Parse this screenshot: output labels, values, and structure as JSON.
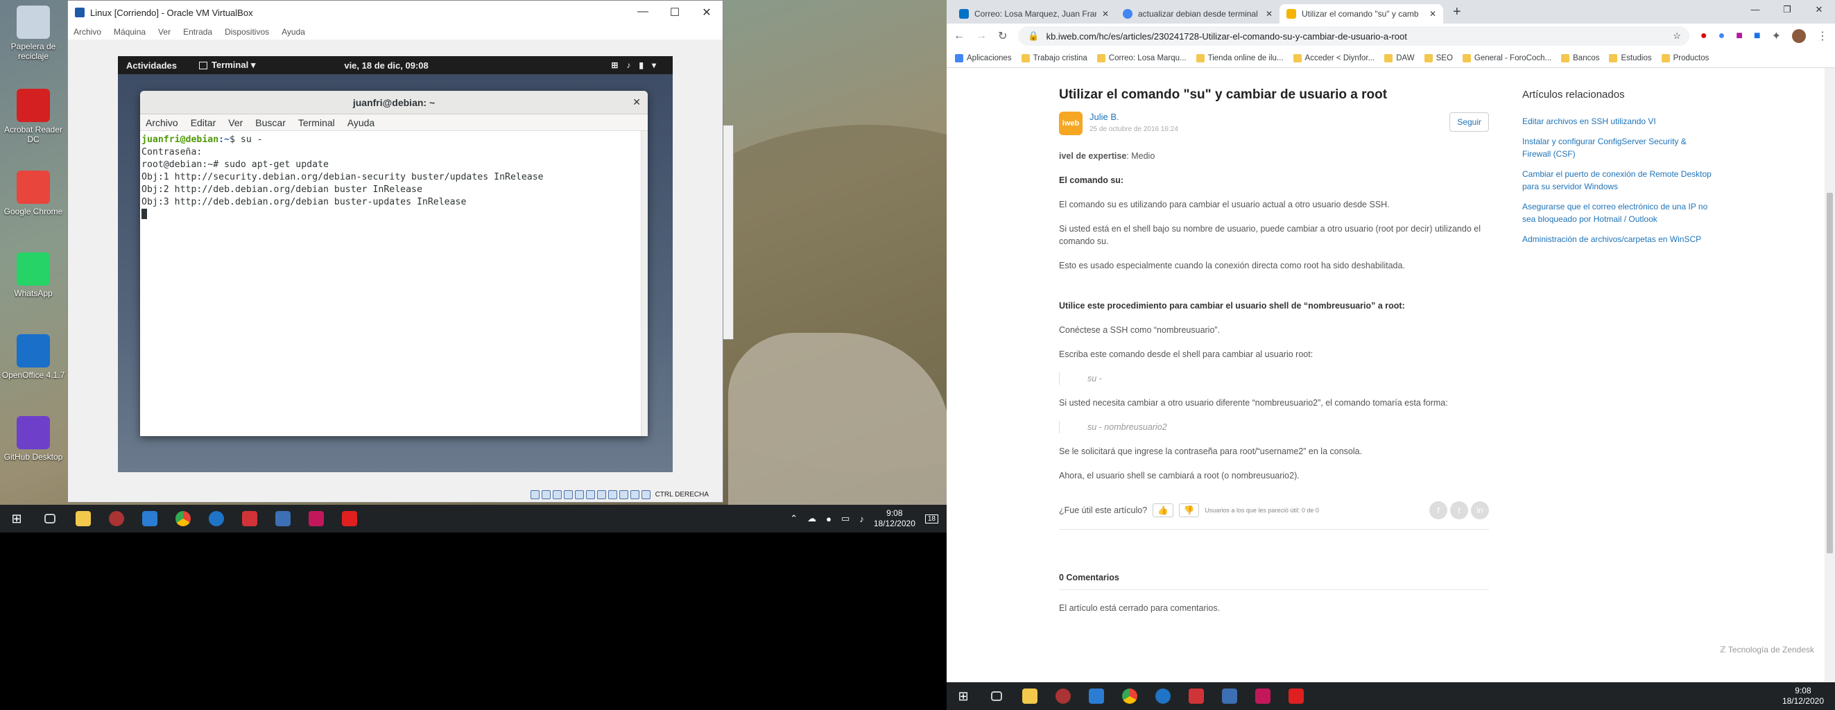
{
  "desktop": {
    "icons": [
      {
        "label": "Papelera de reciclaje",
        "color": "#c8d4e0"
      },
      {
        "label": "Acrobat Reader DC",
        "color": "#d42020"
      },
      {
        "label": "Google Chrome",
        "color": "#e8453c"
      },
      {
        "label": "WhatsApp",
        "color": "#25d366"
      },
      {
        "label": "OpenOffice 4.1.7",
        "color": "#1a6fc9"
      },
      {
        "label": "GitHub Desktop",
        "color": "#6e40c9"
      }
    ]
  },
  "vbox": {
    "title": "Linux [Corriendo] - Oracle VM VirtualBox",
    "menu": [
      "Archivo",
      "Máquina",
      "Ver",
      "Entrada",
      "Dispositivos",
      "Ayuda"
    ],
    "status_text": "CTRL DERECHA",
    "gnome": {
      "activities": "Actividades",
      "app": "Terminal ▾",
      "clock": "vie, 18 de dic, 09:08"
    },
    "terminal": {
      "title": "juanfri@debian: ~",
      "menu": [
        "Archivo",
        "Editar",
        "Ver",
        "Buscar",
        "Terminal",
        "Ayuda"
      ],
      "prompt_user": "juanfri@debian",
      "prompt_path": ":~",
      "line1_cmd": "$ su -",
      "lines": [
        "Contraseña:",
        "root@debian:~# sudo apt-get update",
        "Obj:1 http://security.debian.org/debian-security buster/updates InRelease",
        "Obj:2 http://deb.debian.org/debian buster InRelease",
        "Obj:3 http://deb.debian.org/debian buster-updates InRelease"
      ]
    }
  },
  "left_taskbar": {
    "time": "9:08",
    "date": "18/12/2020",
    "notif": "18"
  },
  "right_taskbar": {
    "time": "9:08",
    "date": "18/12/2020"
  },
  "browser": {
    "tabs": [
      {
        "title": "Correo: Losa Marquez, Juan Franc",
        "color": "#0072c6"
      },
      {
        "title": "actualizar debian desde terminal",
        "color": "#4285f4"
      },
      {
        "title": "Utilizar el comando \"su\" y camb",
        "color": "#f4b400"
      }
    ],
    "url": "kb.iweb.com/hc/es/articles/230241728-Utilizar-el-comando-su-y-cambiar-de-usuario-a-root",
    "bookmarks": [
      "Aplicaciones",
      "Trabajo cristina",
      "Correo: Losa Marqu...",
      "Tienda online de ilu...",
      "Acceder < Diynfor...",
      "DAW",
      "SEO",
      "General - ForoCoch...",
      "Bancos",
      "Estudios",
      "Productos"
    ]
  },
  "article": {
    "title": "Utilizar el comando \"su\" y cambiar de usuario a root",
    "author": "Julie B.",
    "date": "25 de octubre de 2016 16:24",
    "follow": "Seguir",
    "level_label": "ivel de expertise",
    "level_value": ": Medio",
    "h_su": "El comando su:",
    "p1": "El comando su es utilizando para cambiar el usuario actual a otro usuario desde SSH.",
    "p2": "Si usted está en el shell bajo su nombre de usuario,  puede cambiar a otro usuario (root por decir) utilizando el comando su.",
    "p3": "Esto es usado especialmente cuando la conexión directa como root ha sido deshabilitada.",
    "h_proc": "Utilice este procedimiento para cambiar el usuario shell de “nombreusuario” a root:",
    "p4": "Conéctese a SSH como “nombreusuario”.",
    "p5": "Escriba este comando desde el shell para cambiar al usuario root:",
    "code1": "su -",
    "p6": "Si usted necesita cambiar a otro usuario diferente “nombreusuario2”, el comando tomaría esta forma:",
    "code2": "su - nombreusuario2",
    "p7": "Se le solicitará que ingrese la contraseña para root/“username2” en la consola.",
    "p8": "Ahora, el usuario shell se cambiará a root (o nombreusuario2).",
    "useful": "¿Fue útil este artículo?",
    "votes": "Usuarios a los que les pareció útil: 0 de 0",
    "comments_title": "0 Comentarios",
    "comments_closed": "El artículo está cerrado para comentarios.",
    "zendesk": "Tecnología de Zendesk"
  },
  "related": {
    "title": "Artículos relacionados",
    "items": [
      "Editar archivos en SSH utilizando VI",
      "Instalar y configurar ConfigServer Security & Firewall (CSF)",
      "Cambiar el puerto de conexión de Remote Desktop para su servidor Windows",
      "Asegurarse que el correo electrónico de una IP no sea bloqueado por Hotmail / Outlook",
      "Administración de archivos/carpetas en WinSCP"
    ]
  }
}
